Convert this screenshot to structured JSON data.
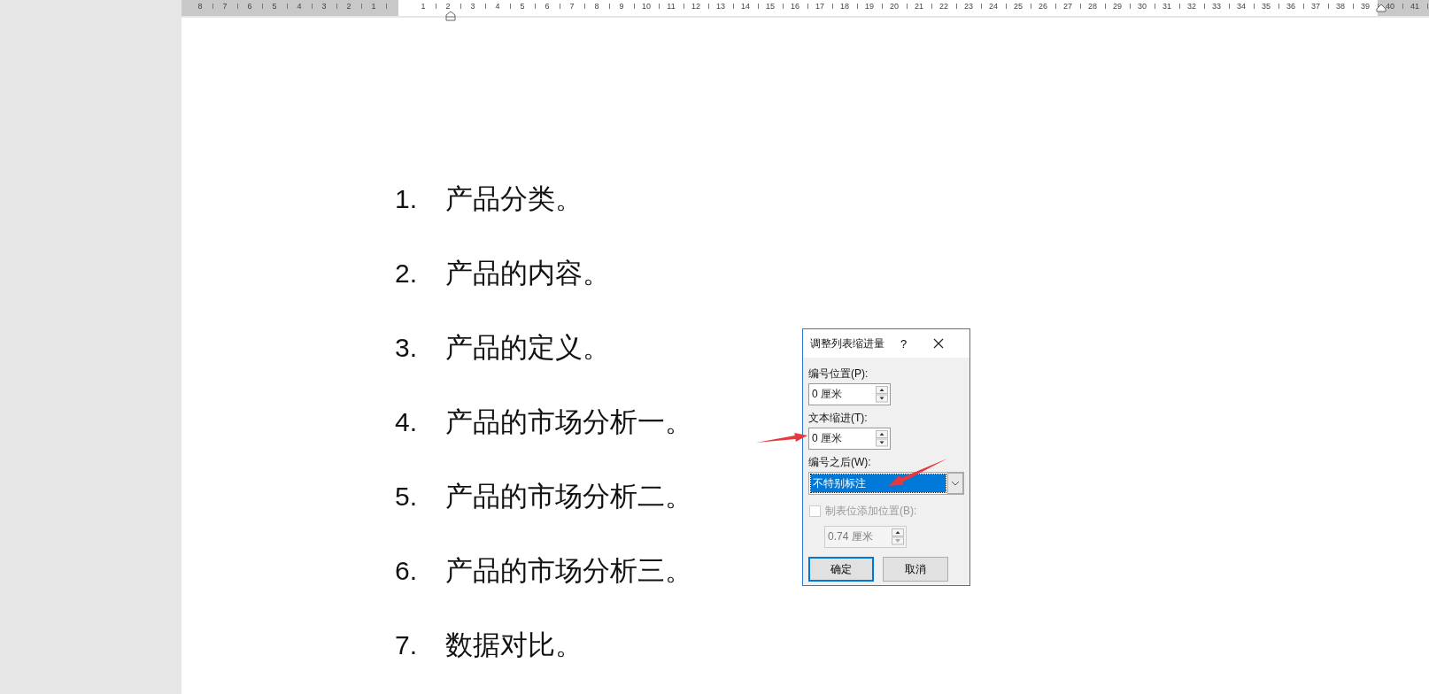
{
  "ruler": {
    "left_margin_numbers": [
      "8",
      "7",
      "6",
      "5",
      "4",
      "3",
      "2",
      "1"
    ],
    "numbers": [
      "1",
      "2",
      "3",
      "4",
      "5",
      "6",
      "7",
      "8",
      "9",
      "10",
      "11",
      "12",
      "13",
      "14",
      "15",
      "16",
      "17",
      "18",
      "19",
      "20",
      "21",
      "22",
      "23",
      "24",
      "25",
      "26",
      "27",
      "28",
      "29",
      "30",
      "31",
      "32",
      "33",
      "34",
      "35",
      "36",
      "37",
      "38",
      "39"
    ],
    "right_margin_numbers": [
      "40",
      "41"
    ]
  },
  "list": [
    {
      "number": "1.",
      "text": "产品分类。"
    },
    {
      "number": "2.",
      "text": "产品的内容。"
    },
    {
      "number": "3.",
      "text": "产品的定义。"
    },
    {
      "number": "4.",
      "text": "产品的市场分析一。"
    },
    {
      "number": "5.",
      "text": "产品的市场分析二。"
    },
    {
      "number": "6.",
      "text": "产品的市场分析三。"
    },
    {
      "number": "7.",
      "text": "数据对比。"
    }
  ],
  "dialog": {
    "title": "调整列表缩进量",
    "help": "?",
    "number_position": {
      "label": "编号位置(P):",
      "value": "0 厘米"
    },
    "text_indent": {
      "label": "文本缩进(T):",
      "value": "0 厘米"
    },
    "after_number": {
      "label": "编号之后(W):",
      "value": "不特别标注"
    },
    "tab_stop": {
      "label": "制表位添加位置(B):",
      "checked": false,
      "disabled": true,
      "value": "0.74 厘米"
    },
    "buttons": [
      {
        "label": "确定",
        "default": true
      },
      {
        "label": "取消",
        "default": false
      }
    ]
  }
}
